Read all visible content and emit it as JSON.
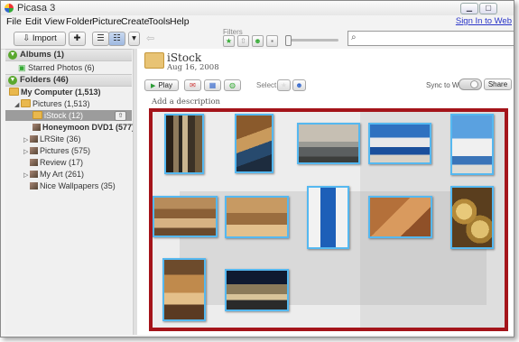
{
  "window": {
    "title": "Picasa 3"
  },
  "menu": [
    "File",
    "Edit",
    "View",
    "Folder",
    "Picture",
    "Create",
    "Tools",
    "Help"
  ],
  "sign_in": "Sign In to Web",
  "toolbar": {
    "import_label": "Import",
    "filters_label": "Filters"
  },
  "sidebar": {
    "albums_header": "Albums (1)",
    "starred": "Starred Photos (6)",
    "folders_header": "Folders (46)",
    "items": [
      {
        "label": "My Computer (1,513)",
        "bold": true
      },
      {
        "label": "Pictures (1,513)"
      },
      {
        "label": "iStock (12)",
        "selected": true
      },
      {
        "label": "Honeymoon DVD1 (577)",
        "bold": true
      },
      {
        "label": "LRSite (36)"
      },
      {
        "label": "Pictures (575)"
      },
      {
        "label": "Review (17)"
      },
      {
        "label": "My Art (261)"
      },
      {
        "label": "Nice Wallpapers (35)"
      }
    ]
  },
  "main": {
    "folder_title": "iStock",
    "folder_date": "Aug 16, 2008",
    "play_label": "Play",
    "select_label": "Select",
    "sync_label": "Sync to Web",
    "share_label": "Share",
    "description": "Add a description"
  },
  "colors": {
    "selection_frame": "#a4141a",
    "photo_border": "#55b8f0",
    "selected_row": "#9c9c9c"
  }
}
